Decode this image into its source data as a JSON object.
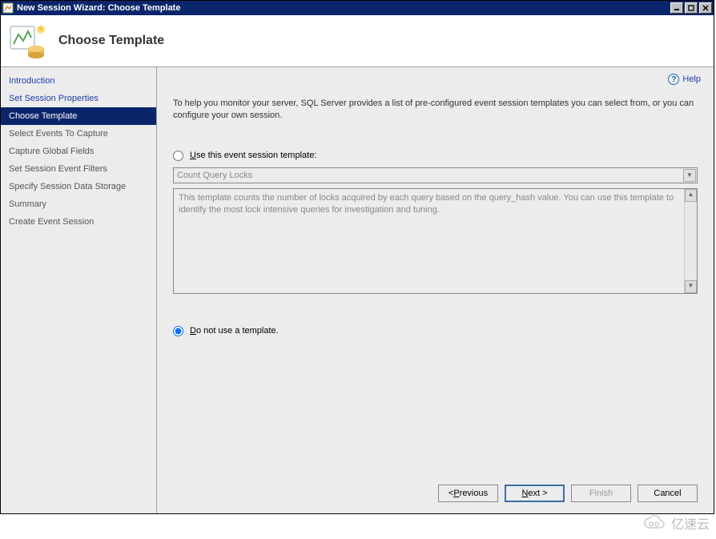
{
  "titlebar": {
    "title": "New Session Wizard: Choose Template"
  },
  "header": {
    "title": "Choose Template"
  },
  "sidebar": {
    "items": [
      {
        "label": "Introduction",
        "kind": "link"
      },
      {
        "label": "Set Session Properties",
        "kind": "link"
      },
      {
        "label": "Choose Template",
        "kind": "selected"
      },
      {
        "label": "Select Events To Capture",
        "kind": "inactive"
      },
      {
        "label": "Capture Global Fields",
        "kind": "inactive"
      },
      {
        "label": "Set Session Event Filters",
        "kind": "inactive"
      },
      {
        "label": "Specify Session Data Storage",
        "kind": "inactive"
      },
      {
        "label": "Summary",
        "kind": "inactive"
      },
      {
        "label": "Create Event Session",
        "kind": "inactive"
      }
    ]
  },
  "main": {
    "help_label": "Help",
    "intro_text": "To help you monitor your server, SQL Server provides a list of pre-configured event session templates you can select from, or you can configure your own session.",
    "option_use_template": {
      "prefix": "U",
      "rest": "se this event session template:",
      "selected": false
    },
    "template_select": {
      "value": "Count Query Locks"
    },
    "template_description": "This template counts the number of locks acquired by each query based on the query_hash value. You can use this template to identify the most lock intensive queries for investigation and tuning.",
    "option_no_template": {
      "prefix": "D",
      "rest": "o not use a template.",
      "selected": true
    }
  },
  "footer": {
    "previous": {
      "head": "< ",
      "mnemonic": "P",
      "rest": "revious"
    },
    "next": {
      "mnemonic": "N",
      "rest": "ext >"
    },
    "finish": "Finish",
    "cancel": "Cancel"
  },
  "watermark": {
    "text": "亿速云"
  }
}
